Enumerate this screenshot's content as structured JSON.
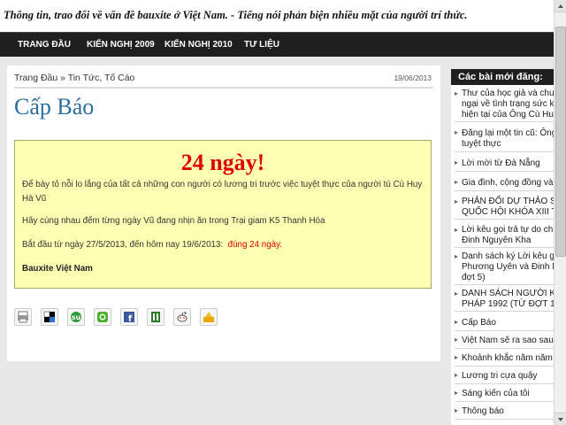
{
  "site": {
    "tagline": "Thông tin, trao đổi về vấn đề bauxite ở Việt Nam. - Tiếng nói phản biện nhiều mặt của người trí thức."
  },
  "nav": [
    {
      "label": "TRANG ĐẦU"
    },
    {
      "label": "KIẾN NGHỊ 2009"
    },
    {
      "label": "KIẾN NGHỊ 2010"
    },
    {
      "label": "TƯ LIỆU"
    }
  ],
  "post": {
    "breadcrumb": "Trang Đầu » Tin Tức, Tố Cáo",
    "date": "19/06/2013",
    "title": "Cấp Báo",
    "notice": {
      "headline": "24 ngày!",
      "p1": "Để bày tỏ nỗi lo lắng của tất cả những con người có lương tri trước việc tuyệt thực của người tù Cù Huy Hà Vũ",
      "p2": "Hãy cùng nhau đếm từng ngày Vũ đang nhịn ăn trong Trại giam K5 Thanh Hóa",
      "p3_prefix": "Bắt đầu từ ngày 27/5/2013, đến hôm nay 19/6/2013:",
      "p3_days": "đúng 24 ngày.",
      "signature": "Bauxite Việt Nam"
    },
    "share_icons": [
      "print-icon",
      "delicious-icon",
      "stumbleupon-icon",
      "chat-icon",
      "facebook-icon",
      "bookmark-icon",
      "reddit-icon",
      "yahoo-icon"
    ]
  },
  "sidebar": {
    "title": "Các bài mới đăng:",
    "items": [
      {
        "lines": [
          "Thư của học giả và chuy",
          "ngại về tình trạng sức k",
          "hiện tại của Ông Cù Huy"
        ]
      },
      {
        "lines": [
          "Đăng lại một tin cũ: Ông",
          "tuyệt thực"
        ]
      },
      {
        "lines": [
          "Lời mời từ Đà Nẵng"
        ]
      },
      {
        "lines": [
          "Gia đình, cộng đồng và"
        ]
      },
      {
        "lines": [
          "PHẢN ĐỐI DỰ THẢO SỬA",
          "QUỐC HỘI KHÓA XIII TẠ"
        ]
      },
      {
        "lines": [
          "Lời kêu gọi trả tự do ch",
          "Đinh Nguyên Kha"
        ]
      },
      {
        "lines": [
          "Danh sách ký Lời kêu g",
          "Phương Uyên và Đinh N",
          "đợt 5)"
        ]
      },
      {
        "lines": [
          "DANH SÁCH NGƯỜI KÝ",
          "PHÁP 1992 (TỪ ĐỢT 1"
        ]
      },
      {
        "lines": [
          "Cấp Báo"
        ]
      },
      {
        "lines": [
          "Việt Nam sẽ ra sao sau"
        ]
      },
      {
        "lines": [
          "Khoảnh khắc năm năm"
        ]
      },
      {
        "lines": [
          "Lương tri cựa quậy"
        ]
      },
      {
        "lines": [
          "Sáng kiến của tôi"
        ]
      },
      {
        "lines": [
          "Thông báo"
        ]
      }
    ]
  }
}
